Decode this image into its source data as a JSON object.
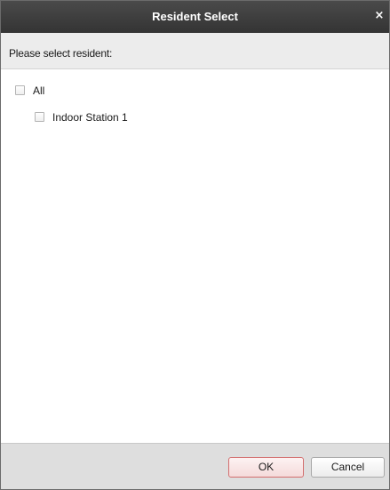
{
  "dialog": {
    "title": "Resident Select",
    "close_label": "×"
  },
  "prompt": {
    "text": "Please select resident:"
  },
  "tree": {
    "items": [
      {
        "label": "All",
        "checked": false,
        "level": 0
      },
      {
        "label": "Indoor Station 1",
        "checked": false,
        "level": 1
      }
    ]
  },
  "footer": {
    "ok_label": "OK",
    "cancel_label": "Cancel"
  },
  "colors": {
    "titlebar": "#3c3c3c",
    "prompt_bg": "#ececec",
    "footer_bg": "#dedede",
    "ok_border": "#d36f6f"
  }
}
